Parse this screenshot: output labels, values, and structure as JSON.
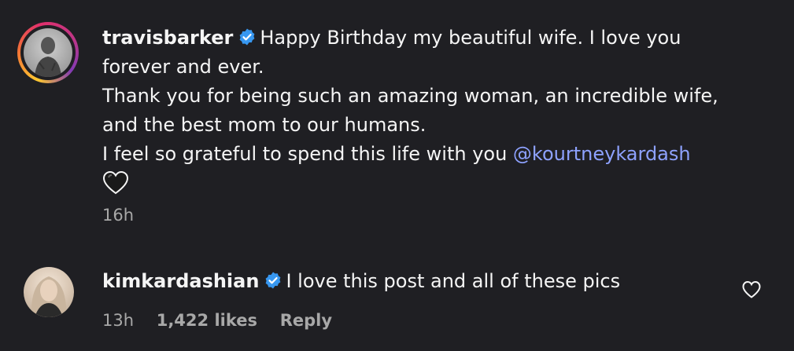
{
  "comments": [
    {
      "username": "travisbarker",
      "lines": [
        "Happy Birthday my beautiful wife. I love you",
        "forever and ever.",
        "Thank you for being such an amazing woman, an incredible wife,",
        "and the best mom to our humans.",
        "I feel so grateful to spend this life with you "
      ],
      "mention": "@kourtneykardash",
      "emoji_icon": "black-heart-icon",
      "time": "16h"
    },
    {
      "username": "kimkardashian",
      "text": "I love this post and all of these pics",
      "time": "13h",
      "likes": "1,422 likes",
      "reply_label": "Reply",
      "like_icon": "heart-outline-icon"
    }
  ],
  "colors": {
    "background": "#1f1f23",
    "verified": "#3797f0",
    "mention": "#8ea2ff",
    "meta_text": "#a8a8a8"
  }
}
